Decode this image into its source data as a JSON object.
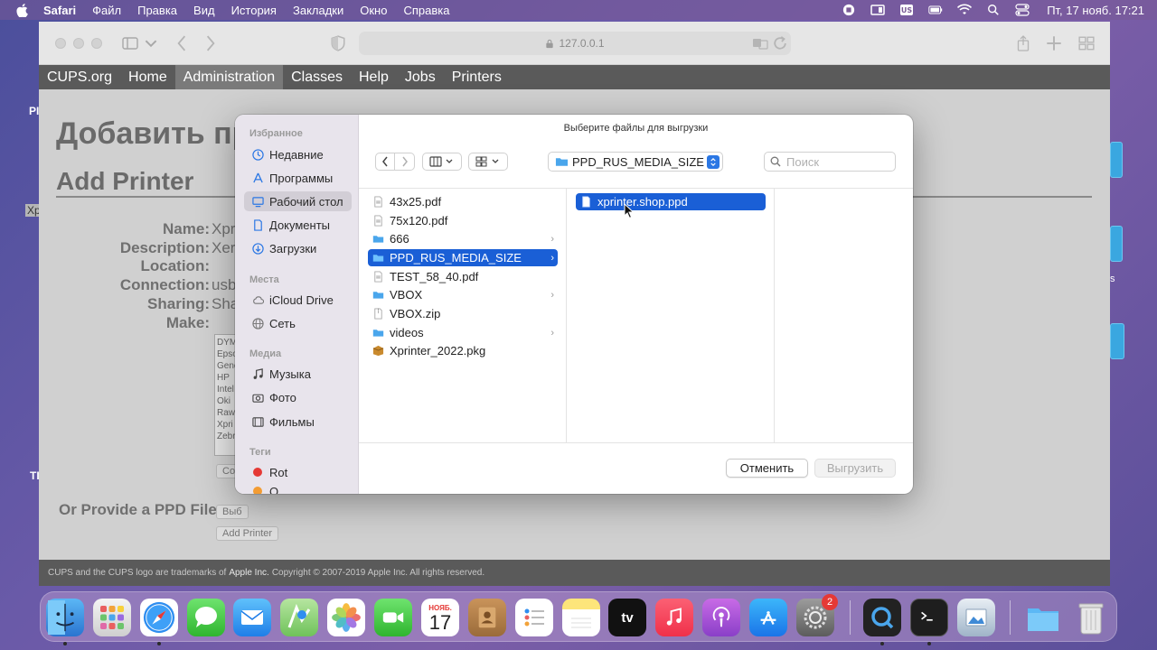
{
  "menubar": {
    "app": "Safari",
    "items": [
      "Файл",
      "Правка",
      "Вид",
      "История",
      "Закладки",
      "Окно",
      "Справка"
    ],
    "clock": "Пт, 17 нояб. 17:21",
    "status_icons": [
      "record-icon",
      "screen-mirror-icon",
      "keyboard-layout-icon",
      "battery-icon",
      "wifi-icon",
      "spotlight-icon",
      "control-center-icon"
    ]
  },
  "safari": {
    "address": "127.0.0.1"
  },
  "cups": {
    "nav": [
      "CUPS.org",
      "Home",
      "Administration",
      "Classes",
      "Help",
      "Jobs",
      "Printers"
    ],
    "active_nav": "Administration",
    "page_title_ru": "Добавить пр",
    "page_title": "Add Printer",
    "form": {
      "name_label": "Name:",
      "name_value": "Xpr",
      "description_label": "Description:",
      "description_value": "Xer",
      "location_label": "Location:",
      "connection_label": "Connection:",
      "connection_value": "usb",
      "sharing_label": "Sharing:",
      "sharing_value": "Sha",
      "make_label": "Make:",
      "makes": [
        "DYM",
        "Epso",
        "Gene",
        "HP",
        "Intel",
        "Oki",
        "Raw",
        "Xpri",
        "Zebr"
      ],
      "continue_btn": "Co",
      "provide_label": "Or Provide a PPD File:",
      "choose_btn": "Выб",
      "add_printer_btn": "Add Printer"
    },
    "footer_prefix": "CUPS and the CUPS logo are trademarks of ",
    "footer_company": "Apple Inc.",
    "footer_suffix": " Copyright © 2007-2019 Apple Inc. All rights reserved."
  },
  "desktop": {
    "left_labels": [
      "PI",
      "Xp",
      "TI"
    ],
    "right_label": "s"
  },
  "dialog": {
    "title": "Выберите файлы для выгрузки",
    "sidebar": {
      "favorites_label": "Избранное",
      "favorites": [
        {
          "label": "Недавние",
          "icon": "clock-icon"
        },
        {
          "label": "Программы",
          "icon": "apps-icon"
        },
        {
          "label": "Рабочий стол",
          "icon": "desktop-icon",
          "selected": true
        },
        {
          "label": "Документы",
          "icon": "document-icon"
        },
        {
          "label": "Загрузки",
          "icon": "download-icon"
        }
      ],
      "places_label": "Места",
      "places": [
        {
          "label": "iCloud Drive",
          "icon": "cloud-icon"
        },
        {
          "label": "Сеть",
          "icon": "globe-icon"
        }
      ],
      "media_label": "Медиа",
      "media": [
        {
          "label": "Музыка",
          "icon": "music-icon"
        },
        {
          "label": "Фото",
          "icon": "camera-icon"
        },
        {
          "label": "Фильмы",
          "icon": "film-icon"
        }
      ],
      "tags_label": "Теги",
      "tags": [
        {
          "label": "Rot",
          "color": "#e53935"
        },
        {
          "label": "O",
          "color": "#f39c33"
        }
      ]
    },
    "path": "PPD_RUS_MEDIA_SIZE",
    "search_placeholder": "Поиск",
    "column1": [
      {
        "name": "43x25.pdf",
        "type": "pdf"
      },
      {
        "name": "75x120.pdf",
        "type": "pdf"
      },
      {
        "name": "666",
        "type": "folder"
      },
      {
        "name": "PPD_RUS_MEDIA_SIZE",
        "type": "folder",
        "selected": true
      },
      {
        "name": "TEST_58_40.pdf",
        "type": "pdf"
      },
      {
        "name": "VBOX",
        "type": "folder"
      },
      {
        "name": "VBOX.zip",
        "type": "zip"
      },
      {
        "name": "videos",
        "type": "folder"
      },
      {
        "name": "Xprinter_2022.pkg",
        "type": "pkg"
      }
    ],
    "column2": [
      {
        "name": "xprinter.shop.ppd",
        "type": "file",
        "selected": true
      }
    ],
    "cancel_label": "Отменить",
    "upload_label": "Выгрузить"
  },
  "dock": {
    "calendar_month": "НОЯБ.",
    "calendar_day": "17",
    "tv_label": "tv",
    "settings_badge": "2"
  },
  "colors": {
    "selection": "#1a5fd6",
    "accent": "#2b77e4",
    "cups_nav": "#5a5a5a"
  }
}
